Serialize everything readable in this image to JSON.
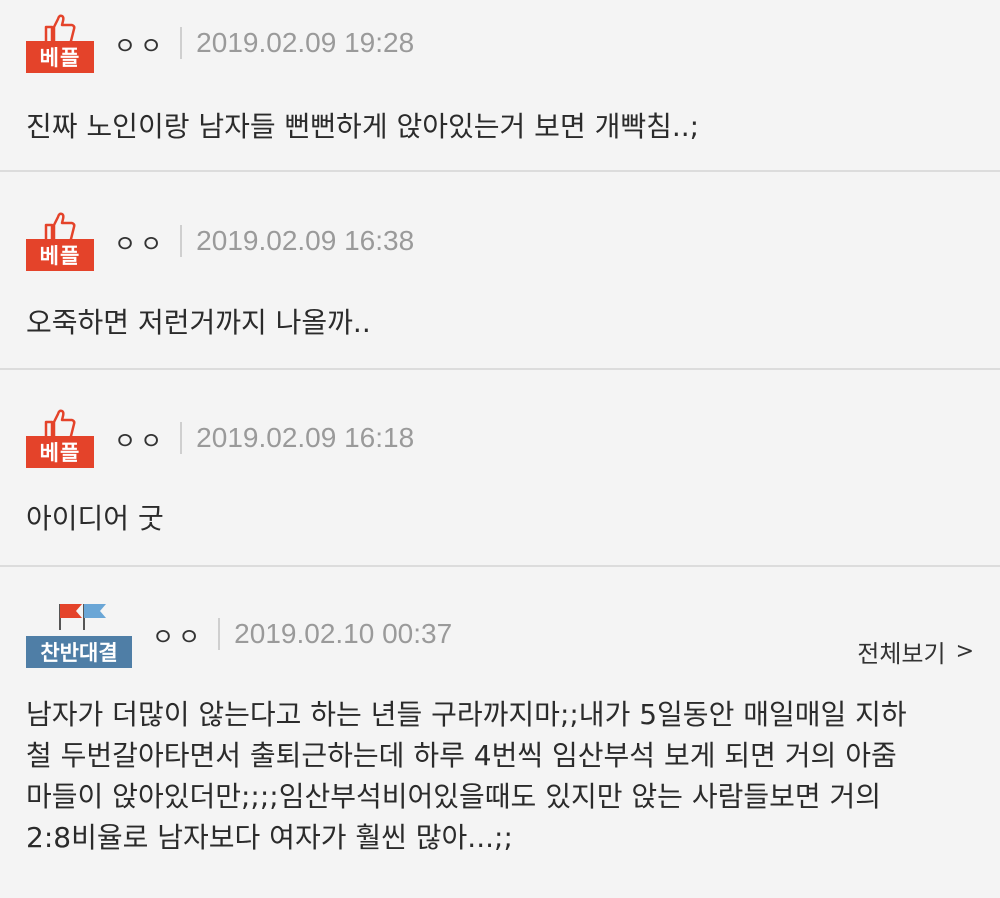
{
  "comments": [
    {
      "badge": "베플",
      "author": "ㅇㅇ",
      "date": "2019.02.09 19:28",
      "text": "진짜 노인이랑 남자들 뻔뻔하게 앉아있는거 보면 개빡침..;"
    },
    {
      "badge": "베플",
      "author": "ㅇㅇ",
      "date": "2019.02.09 16:38",
      "text": "오죽하면 저런거까지 나올까.."
    },
    {
      "badge": "베플",
      "author": "ㅇㅇ",
      "date": "2019.02.09 16:18",
      "text": "아이디어 굿"
    },
    {
      "badge": "찬반대결",
      "author": "ㅇㅇ",
      "date": "2019.02.10 00:37",
      "view_all": "전체보기",
      "lines": [
        "남자가 더많이 않는다고 하는 년들 구라까지마;;내가 5일동안 매일매일 지하",
        "철 두번갈아타면서 출퇴근하는데 하루 4번씩 임산부석 보게 되면 거의 아줌",
        "마들이 앉아있더만;;;;임산부석비어있을때도 있지만 앉는 사람들보면 거의",
        "2:8비율로 남자보다 여자가 훨씬 많아...;;"
      ]
    }
  ],
  "colors": {
    "best_badge": "#e4432a",
    "debate_badge": "#4f7ea6",
    "flag_red": "#e4432a",
    "flag_blue": "#6aa6d6"
  },
  "icons": {
    "best": "thumbs-up-icon",
    "debate": "flags-icon",
    "view_all": "chevron-right-icon"
  }
}
